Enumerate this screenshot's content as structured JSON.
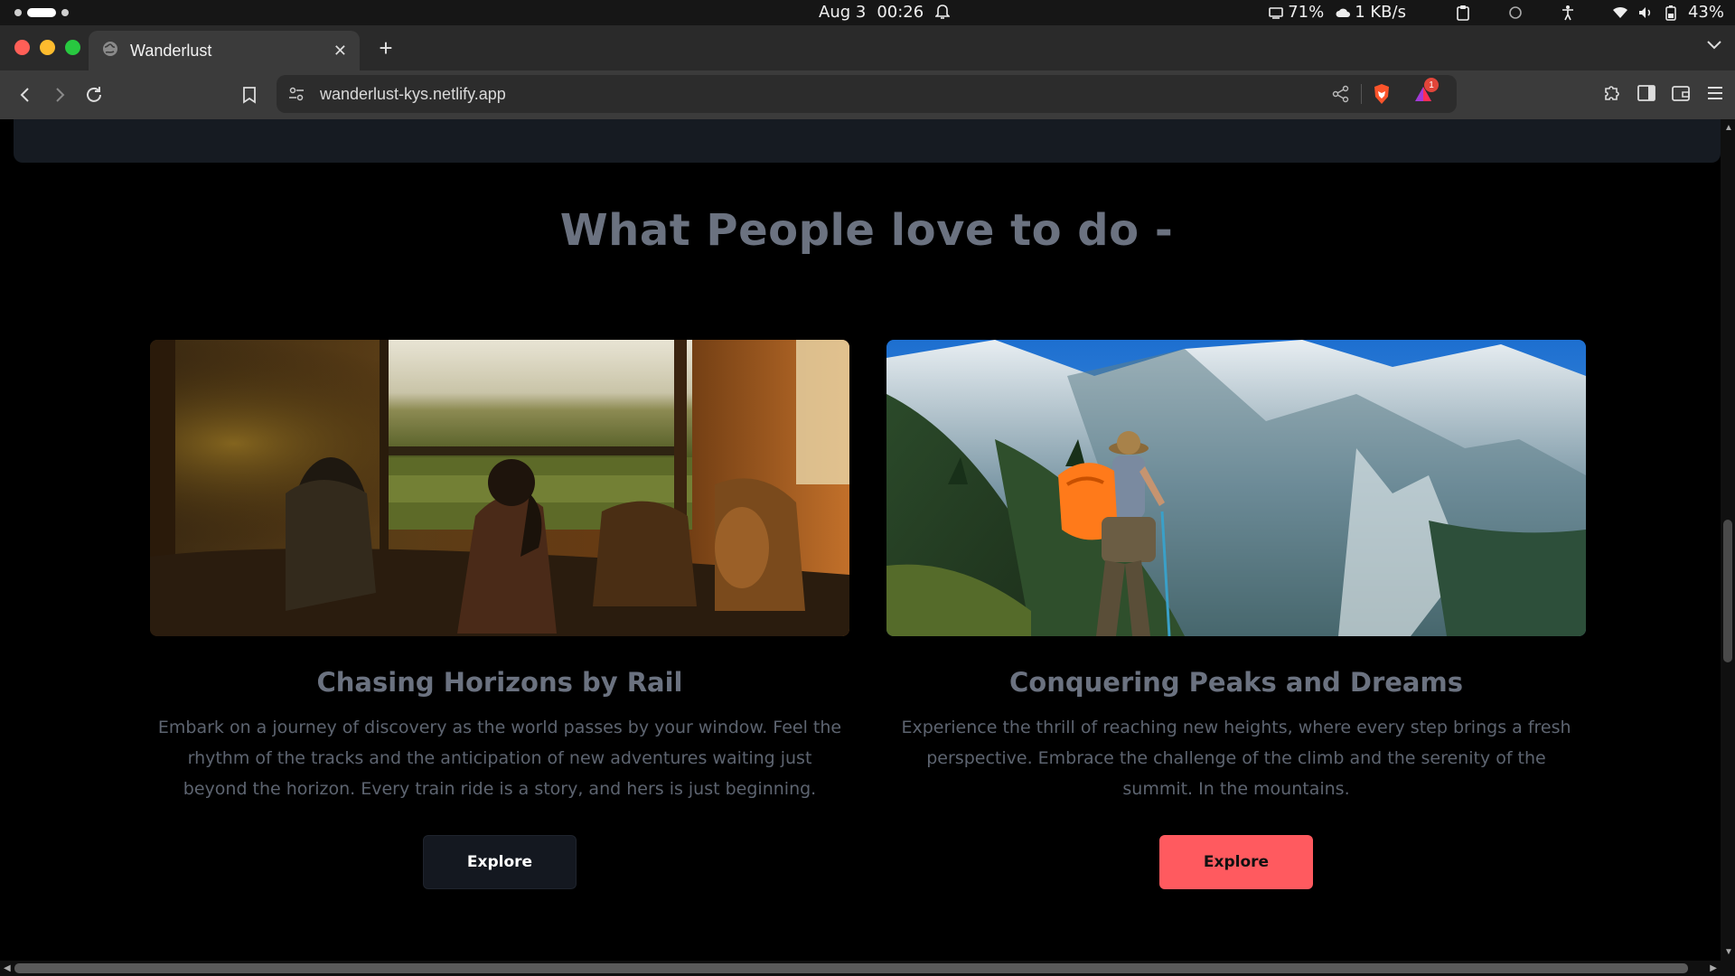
{
  "os_bar": {
    "date": "Aug 3",
    "time": "00:26",
    "cpu": "71%",
    "net": "1 KB/s",
    "battery": "43%",
    "icons": [
      "bell-icon",
      "cpu-icon",
      "cloud-icon",
      "clipboard-icon",
      "circle-icon",
      "accessibility-icon",
      "wifi-icon",
      "volume-icon",
      "battery-icon"
    ]
  },
  "browser": {
    "tab_title": "Wanderlust",
    "url": "wanderlust-kys.netlify.app",
    "brave_alert_count": "1"
  },
  "page": {
    "heading": "What People love to do -",
    "cards": [
      {
        "title": "Chasing Horizons by Rail",
        "description": "Embark on a journey of discovery as the world passes by your window. Feel the rhythm of the tracks and the anticipation of new adventures waiting just beyond the horizon. Every train ride is a story, and hers is just beginning.",
        "button": "Explore",
        "image": "woman looking out train window"
      },
      {
        "title": "Conquering Peaks and Dreams",
        "description": "Experience the thrill of reaching new heights, where every step brings a fresh perspective. Embrace the challenge of the climb and the serenity of the summit. In the mountains.",
        "button": "Explore",
        "image": "hiker with orange backpack facing snowy mountains"
      }
    ]
  },
  "colors": {
    "accent": "#ff5a5f",
    "heading": "#6b7280",
    "dark_button": "#141820"
  }
}
